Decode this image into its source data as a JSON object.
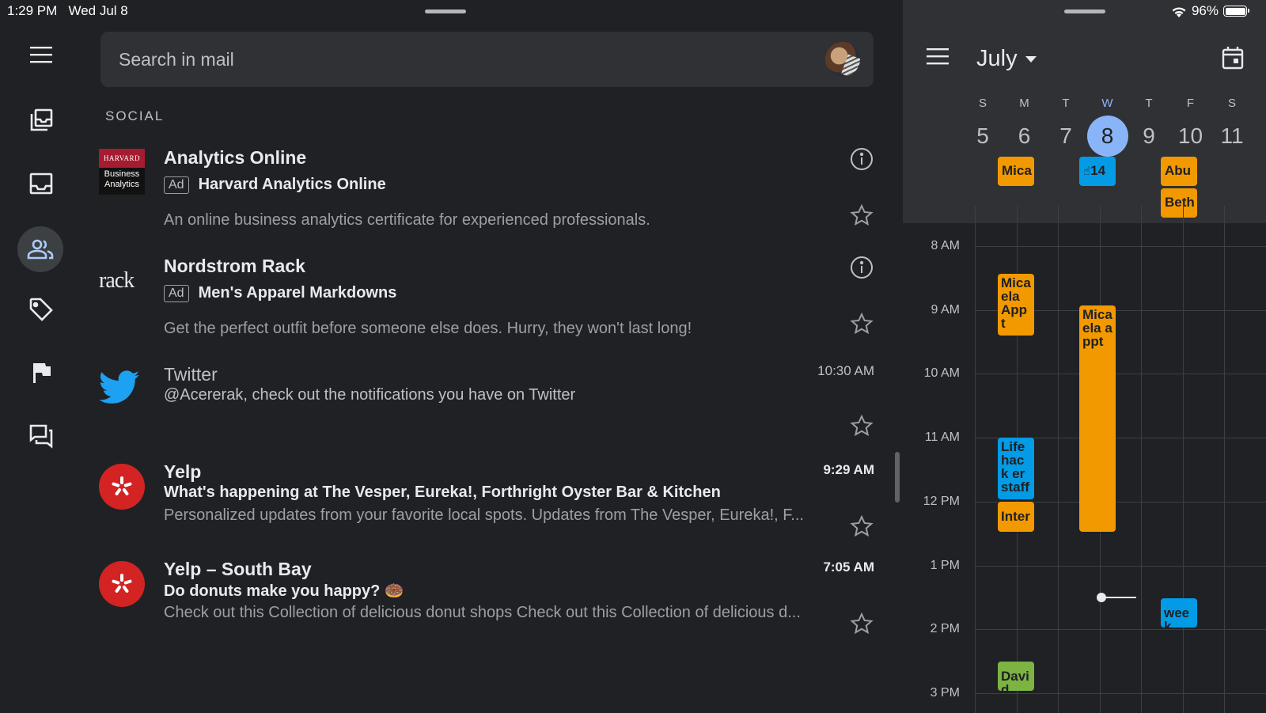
{
  "status": {
    "time": "1:29 PM",
    "date": "Wed Jul 8",
    "battery": "96%"
  },
  "colors": {
    "orange": "#f29900",
    "blue": "#039be5",
    "green": "#7cb342",
    "today": "#8ab4f8",
    "yelp": "#d32323"
  },
  "rail": {
    "items": [
      "all-inboxes-icon",
      "inbox-icon",
      "social-people-icon",
      "promotions-tag-icon",
      "flag-icon",
      "forums-icon"
    ],
    "active": "social-people-icon"
  },
  "search": {
    "placeholder": "Search in mail"
  },
  "section": {
    "label": "SOCIAL"
  },
  "emails": [
    {
      "sender": "Analytics Online",
      "ad": "Ad",
      "subject": "Harvard Analytics Online",
      "snippet": "An online business analytics certificate for experienced professionals.",
      "logo_top": "HARVARD",
      "logo_bottom": "Business Analytics"
    },
    {
      "sender": "Nordstrom Rack",
      "ad": "Ad",
      "subject": "Men's Apparel Markdowns",
      "snippet": "Get the perfect outfit before someone else does. Hurry, they won't last long!",
      "logo_text": "rack"
    },
    {
      "sender": "Twitter",
      "time": "10:30 AM",
      "subject": "@Acererak, check out the notifications you have on Twitter"
    },
    {
      "sender": "Yelp",
      "time": "9:29 AM",
      "subject": "What's happening at The Vesper, Eureka!, Forthright Oyster Bar & Kitchen",
      "snippet": "Personalized updates from your favorite local spots. Updates from The Vesper, Eureka!, F..."
    },
    {
      "sender": "Yelp – South Bay",
      "time": "7:05 AM",
      "subject": "Do donuts make you happy? 🍩",
      "snippet": "Check out this Collection of delicious donut shops Check out this Collection of delicious d..."
    }
  ],
  "calendar": {
    "month": "July",
    "days": [
      {
        "dow": "S",
        "num": "5"
      },
      {
        "dow": "M",
        "num": "6"
      },
      {
        "dow": "T",
        "num": "7"
      },
      {
        "dow": "W",
        "num": "8",
        "today": true
      },
      {
        "dow": "T",
        "num": "9"
      },
      {
        "dow": "F",
        "num": "10"
      },
      {
        "dow": "S",
        "num": "11"
      }
    ],
    "allday": [
      {
        "label": "Mica",
        "day": "M",
        "color": "orange"
      },
      {
        "label": "14",
        "day": "W",
        "color": "blue"
      },
      {
        "label": "Abu",
        "day": "F",
        "color": "orange"
      },
      {
        "label": "Beth",
        "day": "F",
        "color": "orange"
      }
    ],
    "hours": [
      "8 AM",
      "9 AM",
      "10 AM",
      "11 AM",
      "12 PM",
      "1 PM",
      "2 PM",
      "3 PM"
    ],
    "events": [
      {
        "label": "Mica ela Appt",
        "day": "T"
      },
      {
        "label": "Mica ela appt",
        "day": "W"
      },
      {
        "label": "Life hack er staff",
        "day": "T"
      },
      {
        "label": "Inter",
        "day": "T"
      },
      {
        "label": "week",
        "day": "F"
      },
      {
        "label": "David",
        "day": "T"
      }
    ]
  }
}
